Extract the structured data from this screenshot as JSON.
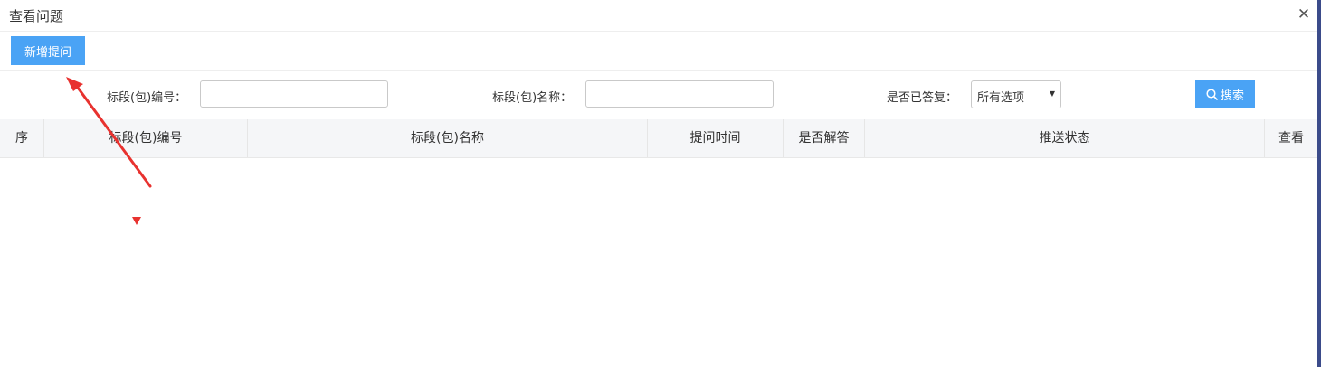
{
  "dialog": {
    "title": "查看问题"
  },
  "toolbar": {
    "add_label": "新增提问"
  },
  "filters": {
    "segment_code_label": "标段(包)编号：",
    "segment_name_label": "标段(包)名称：",
    "answered_label": "是否已答复：",
    "answered_select_value": "所有选项",
    "search_label": "搜索"
  },
  "table": {
    "columns": [
      "序",
      "标段(包)编号",
      "标段(包)名称",
      "提问时间",
      "是否解答",
      "推送状态",
      "查看"
    ],
    "rows": []
  },
  "colors": {
    "accent": "#4aa3f5",
    "annotation": "#e8322f"
  }
}
